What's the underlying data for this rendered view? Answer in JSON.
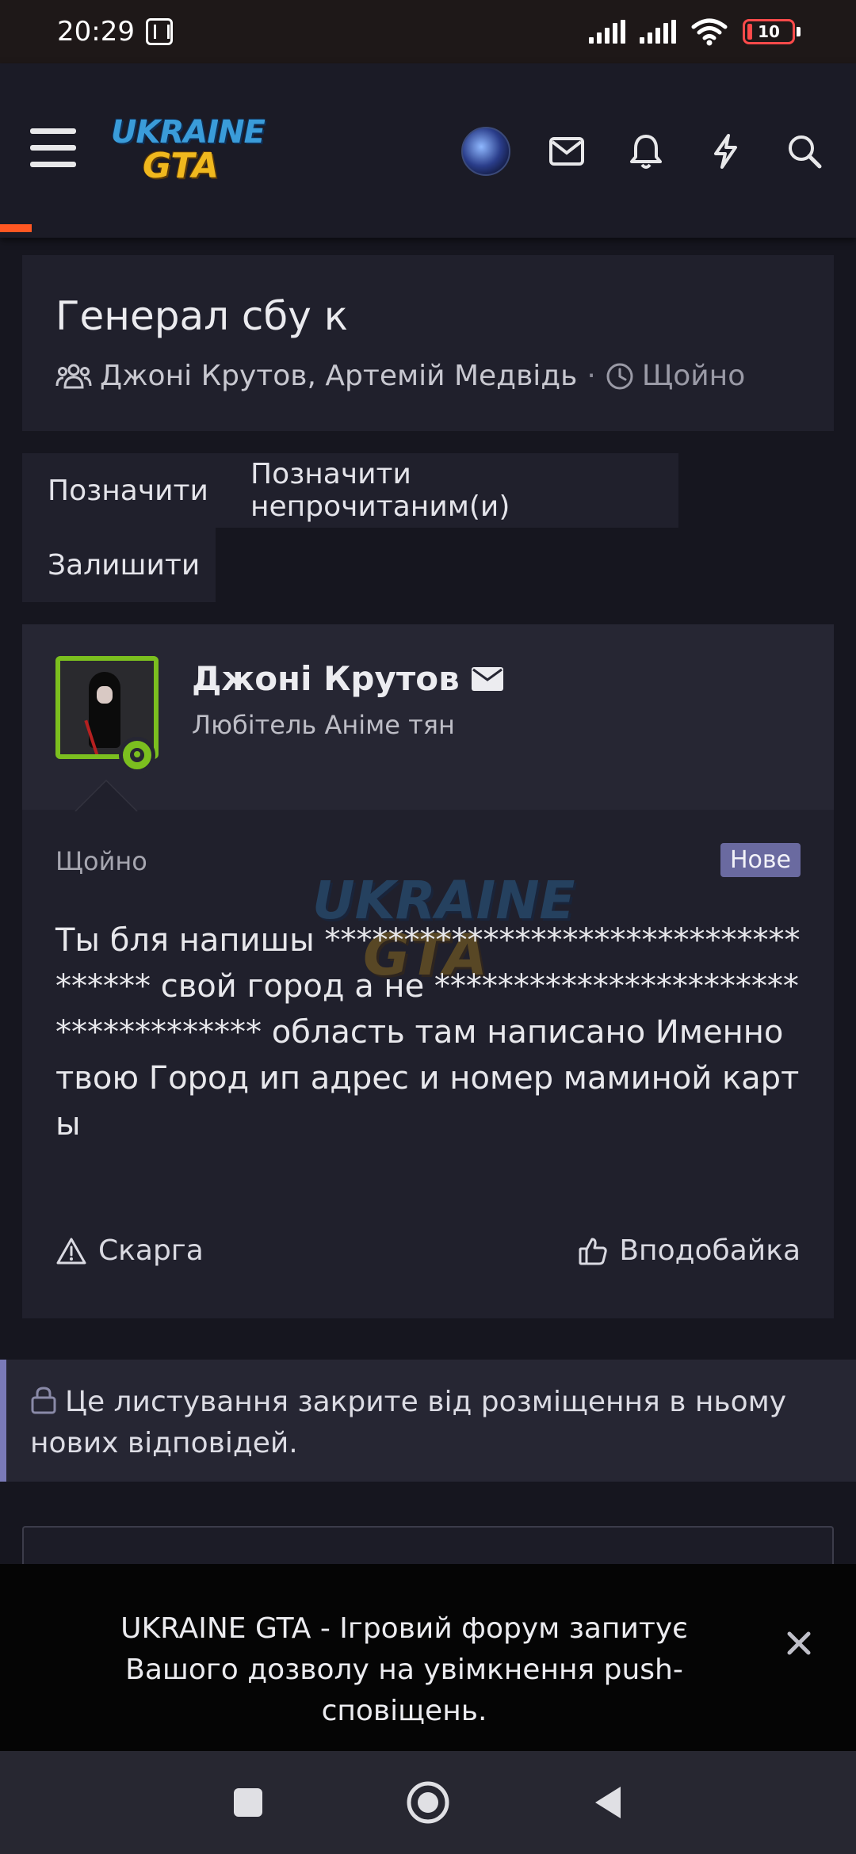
{
  "status_bar": {
    "time": "20:29",
    "battery": "10"
  },
  "header": {
    "logo_line1": "UKRAINE",
    "logo_line2": "GTA",
    "icons": [
      "menu-icon",
      "avatar",
      "envelope-icon",
      "bell-icon",
      "bolt-icon",
      "search-icon"
    ]
  },
  "thread": {
    "title": "Генерал сбу к",
    "participants": "Джоні Крутов, Артемій Медвідь",
    "separator": "·",
    "time": "Щойно"
  },
  "actions": {
    "mark": "Позначити",
    "mark_unread": "Позначити непрочитаним(и)",
    "leave": "Залишити"
  },
  "post": {
    "author": "Джоні Крутов",
    "author_title": "Любітель Аніме тян",
    "time": "Щойно",
    "badge": "Нове",
    "body": "Ты бля напишы ************************************ свой город а не ************************************ область там написано Именно твою Город ип адрес и номер маминой карты",
    "report": "Скарга",
    "like": "Вподобайка"
  },
  "locked_notice": "Це листування закрите від розміщення в ньому нових відповідей.",
  "push_banner": {
    "text": "UKRAINE GTA - Ігровий форум запитує Вашого дозволу на увімкнення push-сповіщень."
  },
  "colors": {
    "accent_orange": "#ff5722",
    "online_green": "#7bbf1f",
    "badge_purple": "#6a6aa0",
    "background": "#16161f"
  }
}
